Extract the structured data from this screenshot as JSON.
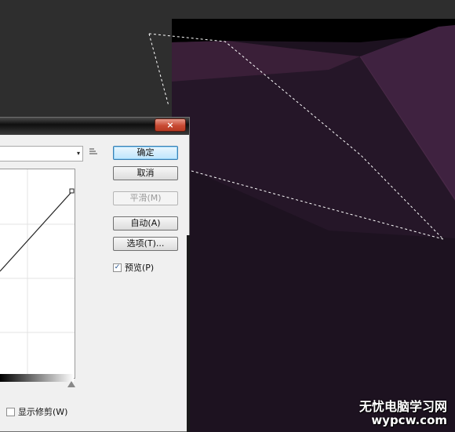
{
  "dialog": {
    "close_symbol": "×",
    "dropdown_arrow": "▾",
    "buttons": {
      "ok": "确定",
      "cancel": "取消",
      "smooth": "平滑(M)",
      "auto": "自动(A)",
      "options": "选项(T)..."
    },
    "preview": {
      "label": "预览(P)",
      "checked": true,
      "check_mark": "✓"
    },
    "show_clipping": {
      "label": "显示修剪(W)",
      "checked": false
    }
  },
  "watermark": {
    "site_name": "无忧电脑学习网",
    "url": "wypcw.com"
  },
  "colors": {
    "canvas_dark": "#1f1420",
    "canvas_purple": "#3b1f38",
    "selection": "#ffffff"
  },
  "icons": {
    "preset_options": "menu-lines-icon",
    "close": "close-icon"
  }
}
